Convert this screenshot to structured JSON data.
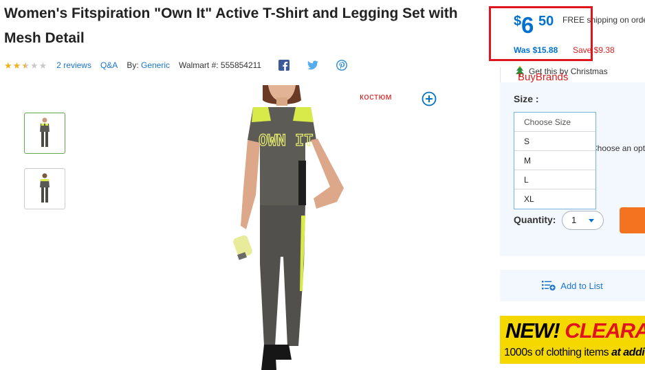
{
  "product": {
    "title": "Women's Fitspiration \"Own It\" Active T-Shirt and Legging Set with Mesh Detail",
    "rating": 2.5,
    "rating_max": 5,
    "reviews_label": "2 reviews",
    "qa_label": "Q&A",
    "by_label": "By:",
    "brand": "Generic",
    "walmart_id": "Walmart #: 555854211",
    "main_image_caption": "OWN IT"
  },
  "price": {
    "currency": "$",
    "dollars": "6",
    "cents": "50",
    "free_shipping": "FREE shipping on orders",
    "was": "Was $15.88",
    "save": "Save $9.38"
  },
  "overlay": {
    "kostyum": "костюм",
    "buybrands": "BuyBrands",
    "highlight_color": "#e0141e"
  },
  "christmas": {
    "label": "Get this by Christmas",
    "icon": "christmas-tree-icon"
  },
  "size": {
    "label": "Size :",
    "placeholder": "Choose Size",
    "options": [
      "S",
      "M",
      "L",
      "XL"
    ],
    "hidden_prompt": "Choose an option"
  },
  "quantity": {
    "label": "Quantity:",
    "value": "1"
  },
  "actions": {
    "add_to_list": "Add to List"
  },
  "banner": {
    "new_text": "NEW!",
    "clearance_text": "CLEARANCE",
    "sub_text": "1000s of clothing items",
    "sub_emphasis": "at additional"
  },
  "colors": {
    "brand_blue": "#0071ce",
    "link_blue": "#1a75cf",
    "sale_red": "#d62020",
    "star_gold": "#f2b01e",
    "cta_orange": "#f47321",
    "banner_yellow": "#f5d800"
  }
}
